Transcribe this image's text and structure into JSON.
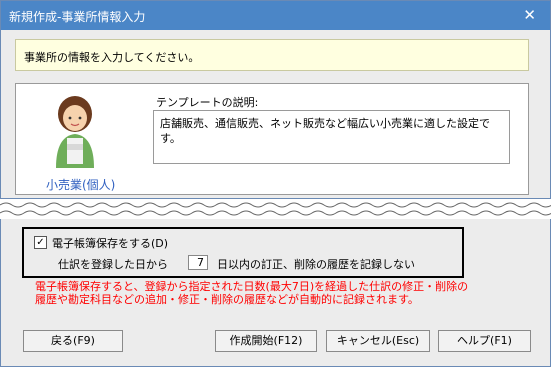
{
  "window": {
    "title": "新規作成-事業所情報入力"
  },
  "instruction": "事業所の情報を入力してください。",
  "template": {
    "avatar_label": "小売業(個人)",
    "heading": "テンプレートの説明:",
    "description_lines": [
      "店舗販売、通信販売、ネット販売など幅広い小売業に適した設定で",
      "す。"
    ]
  },
  "ledger": {
    "checkbox_label": "電子帳簿保存をする(D)",
    "checked": true,
    "row_prefix": "仕訳を登録した日から",
    "days_value": "7",
    "row_suffix": "日以内の訂正、削除の履歴を記録しない",
    "note_lines": [
      "電子帳簿保存すると、登録から指定された日数(最大7日)を経過した仕訳の修正・削除の",
      "履歴や勘定科目などの追加・修正・削除の履歴などが自動的に記録されます。"
    ]
  },
  "buttons": {
    "back": "戻る(F9)",
    "start": "作成開始(F12)",
    "cancel": "キャンセル(Esc)",
    "help": "ヘルプ(F1)"
  },
  "colors": {
    "titlebar": "#4b86c7",
    "note": "#ff0000",
    "instruction_bg": "#ffffe0"
  }
}
